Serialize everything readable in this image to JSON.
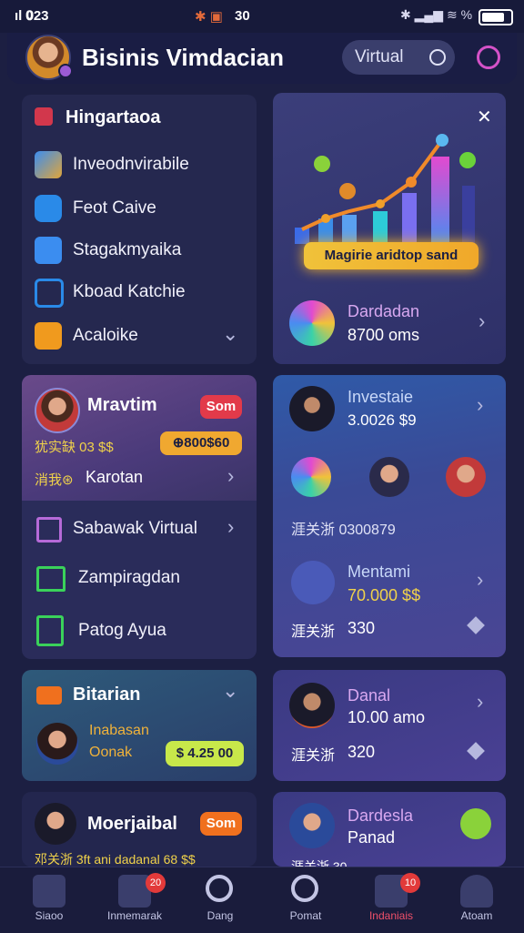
{
  "status_bar": {
    "left": "ıl 𝟎23",
    "center": "30"
  },
  "header": {
    "title": "Bisinis Vimdacian",
    "toggle_label": "Virtual"
  },
  "menu_card": {
    "title": "Hingartaoa",
    "items": [
      {
        "label": "Inveodnvirabile",
        "icon": "puzzle-icon"
      },
      {
        "label": "Feot Caive",
        "icon": "chat-icon"
      },
      {
        "label": "Stagakmyaika",
        "icon": "list-icon"
      },
      {
        "label": "Kboad Katchie",
        "icon": "camera-icon"
      },
      {
        "label": "Acaloike",
        "icon": "box-icon"
      }
    ]
  },
  "chart_card": {
    "banner": "Magirie aridtop sand"
  },
  "dardadan_card": {
    "title": "Dardadan",
    "value": "8700 oms"
  },
  "mravtim_card": {
    "name": "Mravtim",
    "badge": "Som",
    "line1_left": "犹实缺 03 $$",
    "line1_pill": "⊕800$60",
    "line2_left": "消我⊛",
    "line2_label": "Karotan"
  },
  "list_card": {
    "items": [
      {
        "label": "Sabawak Virtual",
        "icon": "checkbox-icon"
      },
      {
        "label": "Zampiragdan",
        "icon": "home-icon"
      },
      {
        "label": "Patog Ayua",
        "icon": "doc-icon"
      }
    ]
  },
  "invest_card": {
    "title": "Investaie",
    "value": "3.0026 $9",
    "code": "涯关浙 0300879",
    "item_title": "Mentami",
    "item_value": "70.000 $$",
    "footer_code": "涯关浙",
    "footer_value": "330"
  },
  "bitarian_card": {
    "title": "Bitarian",
    "person_name": "Inabasan",
    "person_sub": "Oonak",
    "pill": "$ 4.25 00"
  },
  "danal_card": {
    "title": "Danal",
    "value": "10.00 amo",
    "code": "涯关浙",
    "code_value": "320"
  },
  "moer_card": {
    "name": "Moerjaibal",
    "badge": "Som",
    "footer": "邓关浙 3ft ani dadanal 68 $$"
  },
  "dardesla_card": {
    "title": "Dardesla",
    "sub": "Panad",
    "footer": "涯关浙 30"
  },
  "nav": [
    {
      "label": "Siaoo",
      "icon": "home-icon"
    },
    {
      "label": "Inmemarak",
      "icon": "store-icon",
      "badge": "20"
    },
    {
      "label": "Dang",
      "icon": "target-icon"
    },
    {
      "label": "Pomat",
      "icon": "search-icon"
    },
    {
      "label": "Indaniais",
      "icon": "bag-icon",
      "badge": "10"
    },
    {
      "label": "Atoam",
      "icon": "user-icon"
    }
  ]
}
